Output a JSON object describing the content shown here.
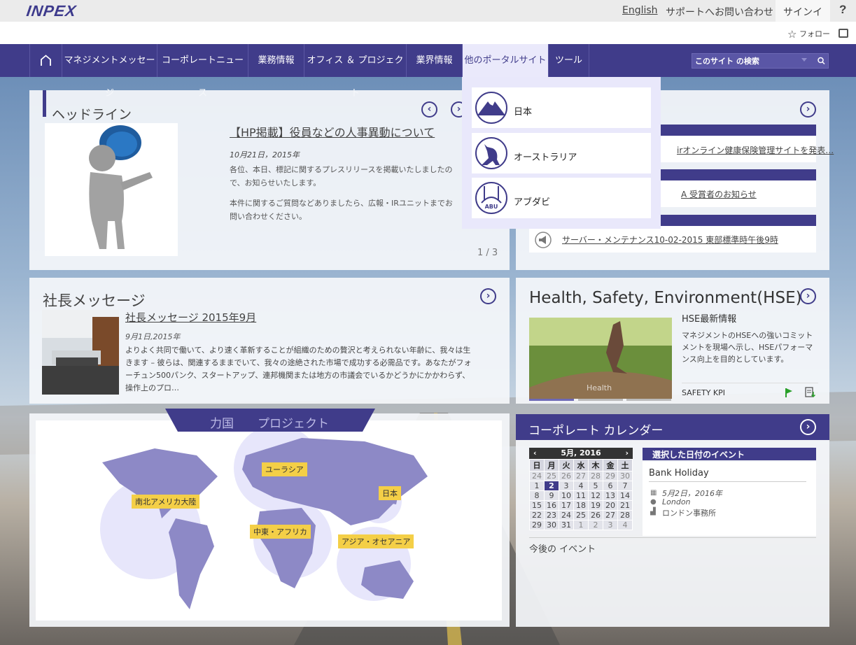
{
  "brand": {
    "logo": "INPEX",
    "accent": "#403c8a"
  },
  "topbar": {
    "english": "English",
    "support": "サポートへお問い合わせ",
    "signin": "サインイン",
    "help": "?",
    "follow": "フォロー"
  },
  "nav": {
    "items": [
      "マネジメントメッセージ",
      "コーポレートニュース",
      "業務情報",
      "オフィス ＆ プロジェクト",
      "業界情報",
      "他のポータルサイト",
      "ツール"
    ],
    "active": "他のポータルサイト",
    "search_placeholder": "このサイト の検索"
  },
  "dropdown": {
    "items": [
      "日本",
      "オーストラリア",
      "アブダビ"
    ],
    "abu_text": "ABU"
  },
  "headline": {
    "title": "ヘッドライン",
    "news_title": "【HP掲載】役員などの人事異動について",
    "date": "10月21日，2015年",
    "p1": "各位、本日、標記に関するプレスリリースを掲載いたしましたので、お知らせいたします。",
    "p2": "本件に関するご質問などありましたら、広報・IRユニットまでお問い合わせください。",
    "pager": "1 / 3"
  },
  "news": {
    "item1": "irオンライン健康保険管理サイトを発表…",
    "item2": "A 受賞者のお知らせ",
    "item3": "サーバー・メンテナンス10-02-2015  東部標準時午後9時"
  },
  "ceo": {
    "title": "社長メッセージ",
    "link": "社長メッセージ 2015年9月",
    "date": "9月1日,2015年",
    "text": "よりよく共同で働いて、より速く革新することが組織のための贅沢と考えられない年齢に、我々は生きます – 彼らは、関連するままでいて、我々の途絶された市場で成功する必需品です。あなたがフォーチュン500パンク、スタートアップ、連邦機関または地方の市議会でいるかどうかにかかわらず、操作上のプロ…"
  },
  "hse": {
    "title": "Health, Safety, Environment(HSE)",
    "subtitle": "HSE最新情報",
    "text": "マネジメントのHSEへの強いコミットメントを現場へ示し、HSEパフォーマンス向上を目的としています。",
    "kpi": "SAFETY KPI",
    "image_caption": "Health"
  },
  "map": {
    "tab_text": "力国　　プロジェクト",
    "regions": [
      "南北アメリカ大陸",
      "ユーラシア",
      "中東・アフリカ",
      "日本",
      "アジア・オセアニア"
    ]
  },
  "calendar": {
    "title": "コーポレート カレンダー",
    "month": "5月, 2016",
    "weekdays": [
      "日",
      "月",
      "火",
      "水",
      "木",
      "金",
      "土"
    ],
    "weeks": [
      [
        "24",
        "25",
        "26",
        "27",
        "28",
        "29",
        "30"
      ],
      [
        "1",
        "2",
        "3",
        "4",
        "5",
        "6",
        "7"
      ],
      [
        "8",
        "9",
        "10",
        "11",
        "12",
        "13",
        "14"
      ],
      [
        "15",
        "16",
        "17",
        "18",
        "19",
        "20",
        "21"
      ],
      [
        "22",
        "23",
        "24",
        "25",
        "26",
        "27",
        "28"
      ],
      [
        "29",
        "30",
        "31",
        "1",
        "2",
        "3",
        "4"
      ]
    ],
    "selected": "2",
    "events_header": "選択した日付のイベント",
    "event_title": "Bank Holiday",
    "event_date": "5月2日，2016年",
    "event_location": "London",
    "event_office": "ロンドン事務所",
    "upcoming": "今後の イベント"
  }
}
